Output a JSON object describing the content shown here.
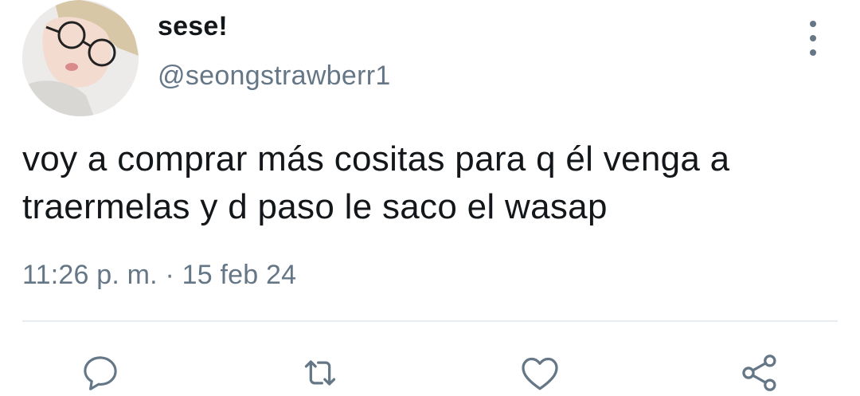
{
  "author": {
    "display_name": "sese!",
    "handle": "@seongstrawberr1"
  },
  "tweet": {
    "text": "voy a comprar más cositas para q él venga a\ntraermelas y d paso le saco el wasap",
    "time": "11:26 p. m.",
    "separator": "·",
    "date": "15 feb 24"
  },
  "actions": [
    {
      "icon": "reply-icon"
    },
    {
      "icon": "retweet-icon"
    },
    {
      "icon": "like-icon"
    },
    {
      "icon": "share-icon"
    }
  ],
  "colors": {
    "text": "#14171a",
    "secondary": "#657786",
    "divider": "#e6ecf0"
  }
}
